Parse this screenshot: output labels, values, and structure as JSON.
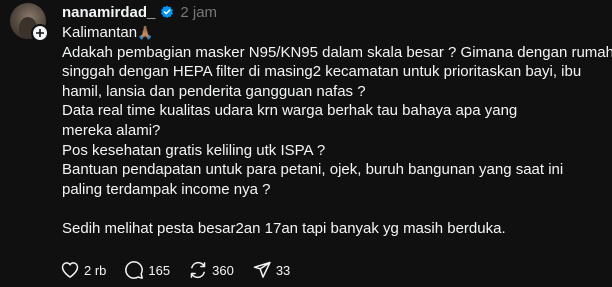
{
  "post": {
    "username": "nanamirdad_",
    "timestamp": "2 jam",
    "lines": [
      "Kalimantan",
      "Adakah pembagian masker N95/KN95 dalam skala besar ? Gimana dengan rumah",
      "singgah dengan HEPA filter di masing2 kecamatan untuk prioritaskan bayi, ibu",
      "hamil, lansia dan penderita gangguan nafas ?",
      "Data real time kualitas udara krn warga berhak tau bahaya apa yang",
      "mereka alami?",
      "Pos kesehatan gratis keliling utk ISPA ?",
      "Bantuan pendapatan untuk para petani, ojek, buruh bangunan yang saat ini",
      "paling terdampak income nya ?"
    ],
    "emoji": "🙏🏽",
    "closing_line": "Sedih melihat pesta besar2an 17an tapi banyak yg masih berduka."
  },
  "actions": {
    "likes": "2 rb",
    "replies": "165",
    "reposts": "360",
    "shares": "33"
  },
  "icons": {
    "verified": "verified-badge-icon",
    "follow": "plus-icon",
    "like": "heart-icon",
    "reply": "comment-icon",
    "repost": "repost-icon",
    "share": "send-icon"
  },
  "colors": {
    "background": "#101010",
    "text": "#f3f5f7",
    "muted": "#777777",
    "verified": "#0095f6"
  }
}
